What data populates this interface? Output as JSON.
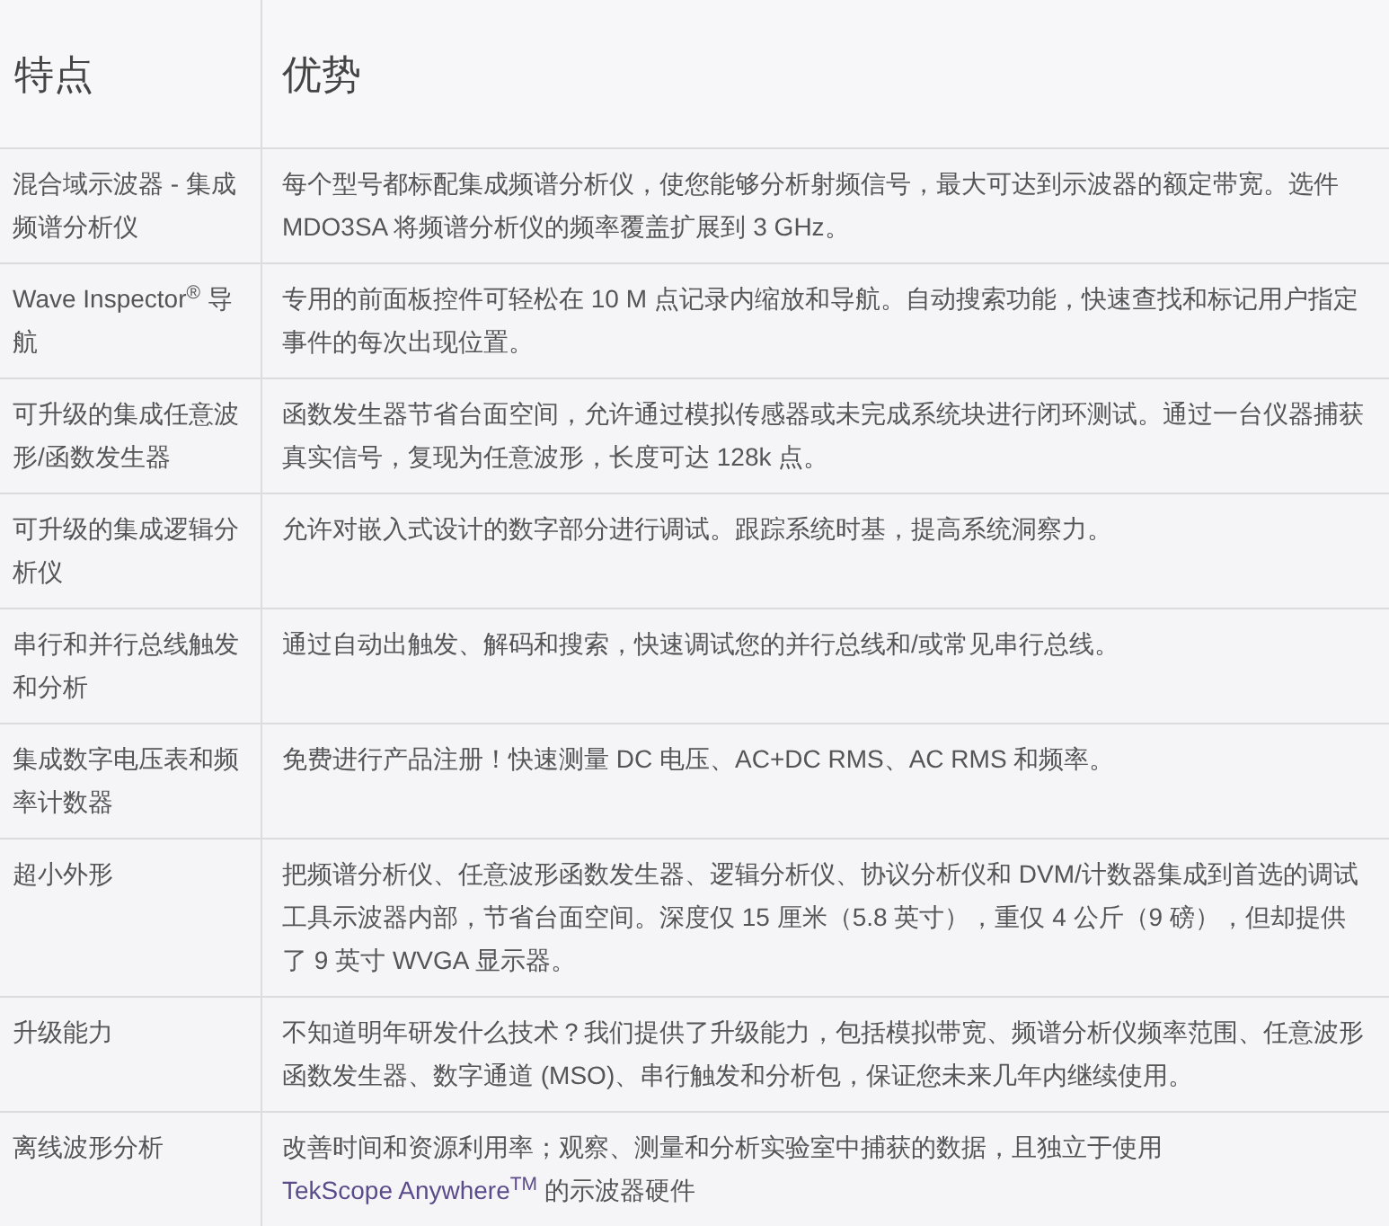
{
  "table": {
    "columns": [
      "特点",
      "优势"
    ],
    "rows": [
      {
        "feature": "混合域示波器 - 集成频谱分析仪",
        "description": "每个型号都标配集成频谱分析仪，使您能够分析射频信号，最大可达到示波器的额定带宽。选件 MDO3SA 将频谱分析仪的频率覆盖扩展到 3 GHz。"
      },
      {
        "feature": "Wave Inspector$^{®}$ 导航",
        "description": "专用的前面板控件可轻松在 10 M 点记录内缩放和导航。自动搜索功能，快速查找和标记用户指定事件的每次出现位置。"
      },
      {
        "feature": "可升级的集成任意波形/函数发生器",
        "description": "函数发生器节省台面空间，允许通过模拟传感器或未完成系统块进行闭环测试。通过一台仪器捕获真实信号，复现为任意波形，长度可达 128k 点。"
      },
      {
        "feature": "可升级的集成逻辑分析仪",
        "description": "允许对嵌入式设计的数字部分进行调试。跟踪系统时基，提高系统洞察力。"
      },
      {
        "feature": "串行和并行总线触发和分析",
        "description": "通过自动出触发、解码和搜索，快速调试您的并行总线和/或常见串行总线。"
      },
      {
        "feature": "集成数字电压表和频率计数器",
        "description": "免费进行产品注册！快速测量 DC 电压、AC+DC RMS、AC RMS 和频率。"
      },
      {
        "feature": "超小外形",
        "description": "把频谱分析仪、任意波形函数发生器、逻辑分析仪、协议分析仪和 DVM/计数器集成到首选的调试工具示波器内部，节省台面空间。深度仅 15 厘米（5.8 英寸），重仅 4 公斤（9 磅），但却提供了 9 英寸 WVGA 显示器。"
      },
      {
        "feature": "升级能力",
        "description": "不知道明年研发什么技术？我们提供了升级能力，包括模拟带宽、频谱分析仪频率范围、任意波形函数发生器、数字通道 (MSO)、串行触发和分析包，保证您未来几年内继续使用。"
      },
      {
        "feature": "离线波形分析",
        "description": "改善时间和资源利用率；观察、测量和分析实验室中捕获的数据，且独立于使用 ",
        "link": "TekScope Anywhere$^{TM}$",
        "after": " 的示波器硬件"
      }
    ]
  }
}
